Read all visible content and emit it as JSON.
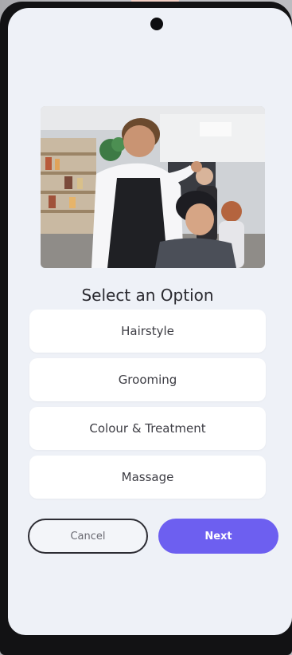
{
  "screen": {
    "heading": "Select an Option",
    "hero_image": "barber-styling-customer-hair-photo"
  },
  "options": [
    {
      "label": "Hairstyle"
    },
    {
      "label": "Grooming"
    },
    {
      "label": "Colour & Treatment"
    },
    {
      "label": "Massage"
    }
  ],
  "actions": {
    "cancel_label": "Cancel",
    "next_label": "Next"
  },
  "colors": {
    "accent": "#6d5ff0",
    "screen_bg": "#eef1f7",
    "card_bg": "#ffffff",
    "text": "#2a2a30"
  }
}
